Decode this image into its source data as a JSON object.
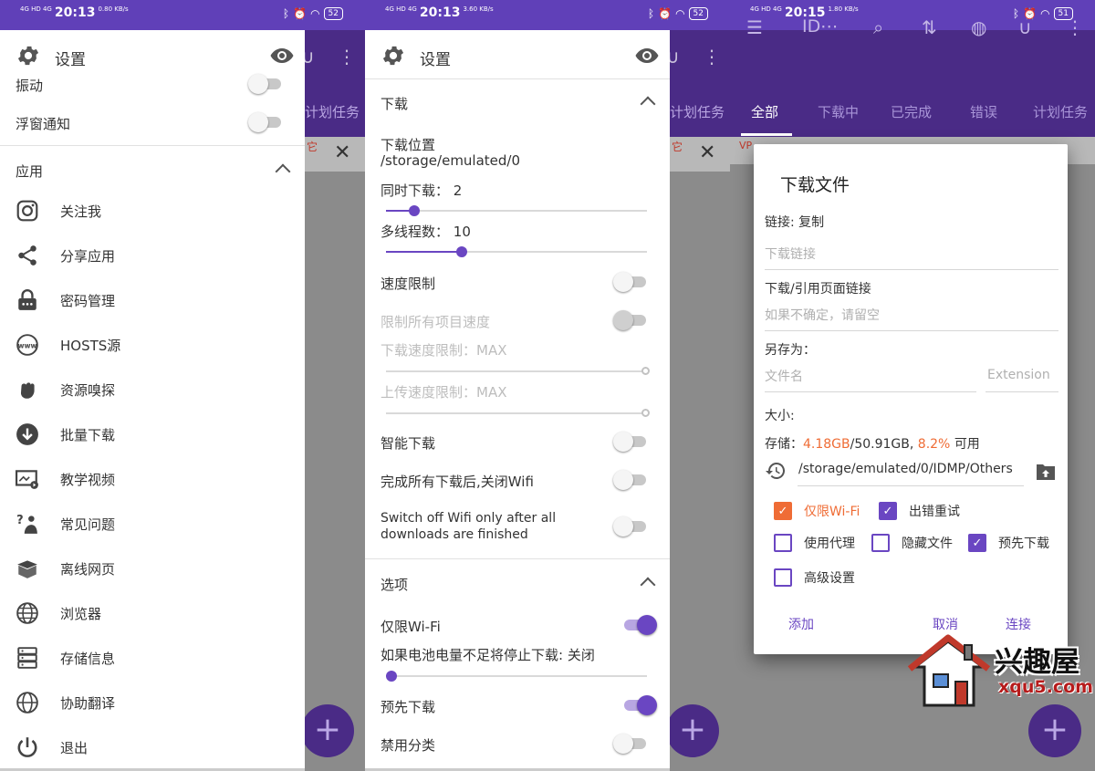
{
  "screen1": {
    "status": {
      "net": "4G HD 4G",
      "time": "20:13",
      "speed": "0.80 KB/s",
      "battery": "52"
    },
    "header": {
      "title": "设置"
    },
    "settings_rows": [
      {
        "label": "振动",
        "on": false
      },
      {
        "label": "浮窗通知",
        "on": false
      }
    ],
    "section_app": "应用",
    "menu": [
      {
        "label": "关注我",
        "icon": "instagram-icon"
      },
      {
        "label": "分享应用",
        "icon": "share-icon"
      },
      {
        "label": "密码管理",
        "icon": "lock-icon"
      },
      {
        "label": "HOSTS源",
        "icon": "www-icon"
      },
      {
        "label": "资源嗅探",
        "icon": "fist-icon"
      },
      {
        "label": "批量下载",
        "icon": "download-circle-icon"
      },
      {
        "label": "教学视频",
        "icon": "video-tutorial-icon"
      },
      {
        "label": "常见问题",
        "icon": "faq-icon"
      },
      {
        "label": "离线网页",
        "icon": "offline-box-icon"
      },
      {
        "label": "浏览器",
        "icon": "globe-icon"
      },
      {
        "label": "存储信息",
        "icon": "storage-icon"
      },
      {
        "label": "协助翻译",
        "icon": "translate-globe-icon"
      },
      {
        "label": "退出",
        "icon": "power-icon"
      }
    ],
    "backdrop": {
      "tab_fragment": "计划任务",
      "banner_fragment": "它"
    }
  },
  "screen2": {
    "status": {
      "net": "4G HD 4G",
      "time": "20:13",
      "speed": "3.60 KB/s",
      "battery": "52"
    },
    "header": {
      "title": "设置"
    },
    "section_download": "下载",
    "download_location_label": "下载位置",
    "download_location_value": "/storage/emulated/0",
    "concurrent_label": "同时下载：",
    "concurrent_value": "2",
    "concurrent_fraction": 0.11,
    "threads_label": "多线程数：",
    "threads_value": "10",
    "threads_fraction": 0.29,
    "speed_limit": {
      "label": "速度限制",
      "on": false
    },
    "limit_all": {
      "label": "限制所有项目速度",
      "on": false
    },
    "download_limit_label": "下载速度限制：",
    "download_limit_value": "MAX",
    "upload_limit_label": "上传速度限制：",
    "upload_limit_value": "MAX",
    "smart_download": {
      "label": "智能下载",
      "on": false
    },
    "wifi_off_cn": {
      "label": "完成所有下载后,关闭Wifi",
      "on": false
    },
    "wifi_off_en_line1": "Switch off Wifi only after all",
    "wifi_off_en_line2": "downloads are finished",
    "section_options": "选项",
    "wifi_only": {
      "label": "仅限Wi-Fi",
      "on": true
    },
    "battery_label": "如果电池电量不足将停止下载: 关闭",
    "battery_fraction": 0.0,
    "predownload": {
      "label": "预先下载",
      "on": true
    },
    "disable_category": {
      "label": "禁用分类",
      "on": false
    },
    "backdrop": {
      "tab_fragment": "计划任务",
      "banner_fragment": "它"
    }
  },
  "screen3": {
    "status": {
      "net": "4G HD 4G",
      "time": "20:15",
      "speed": "1.80 KB/s",
      "battery": "51"
    },
    "toolbar": {
      "title": "ID⋯"
    },
    "tabs": [
      "全部",
      "下载中",
      "已完成",
      "错误",
      "计划任务"
    ],
    "banner": "VP",
    "dialog": {
      "title": "下载文件",
      "link_label": "链接: 复制",
      "link_placeholder": "下载链接",
      "referer_label": "下载/引用页面链接",
      "referer_placeholder": "如果不确定，请留空",
      "saveas_label": "另存为：",
      "filename_placeholder": "文件名",
      "extension_placeholder": "Extension",
      "size_label": "大小:",
      "storage_prefix": "存储：",
      "storage_free": "4.18GB",
      "storage_total": "/50.91GB,",
      "storage_percent": "8.2%",
      "storage_suffix": "可用",
      "path": "/storage/emulated/0/IDMP/Others",
      "checkboxes": [
        {
          "label": "仅限Wi-Fi",
          "checked": true,
          "style": "orange"
        },
        {
          "label": "出错重试",
          "checked": true
        },
        {
          "label": "使用代理",
          "checked": false
        },
        {
          "label": "隐藏文件",
          "checked": false
        },
        {
          "label": "预先下载",
          "checked": true
        },
        {
          "label": "高级设置",
          "checked": false
        }
      ],
      "btn_add": "添加",
      "btn_cancel": "取消",
      "btn_connect": "连接"
    }
  },
  "watermark": {
    "title": "兴趣屋",
    "domain": "xqu5.com"
  },
  "colors": {
    "primary": "#6040b8",
    "accent": "#6a46c2",
    "orange": "#ef6c35"
  }
}
